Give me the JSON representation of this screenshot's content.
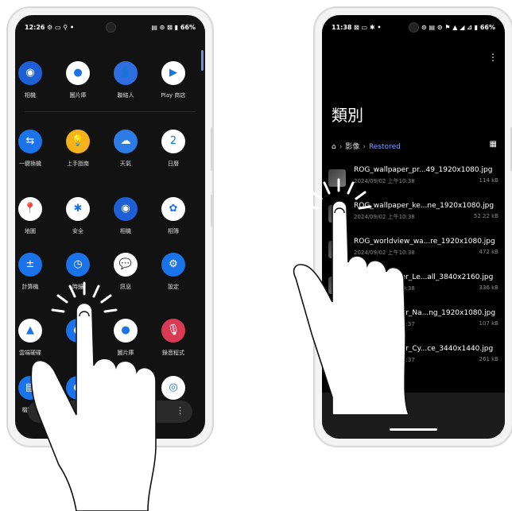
{
  "left_phone": {
    "status_bar": {
      "time": "12:26",
      "icons_left": "⚙ ▭ ⚲ •",
      "battery": "66%",
      "icons_right": "▤ ⊙ ⊠ ▮"
    },
    "apps": [
      {
        "label": "相機",
        "color": "#1f5fd6",
        "glyph": "◉"
      },
      {
        "label": "圖片庫",
        "color": "#ffffff",
        "glyph": "●"
      },
      {
        "label": "聯絡人",
        "color": "#2f6ee0",
        "glyph": "👤"
      },
      {
        "label": "Play 商店",
        "color": "#ffffff",
        "glyph": "▶"
      },
      {
        "label": "一鍵換機",
        "color": "#1a73e8",
        "glyph": "⇆"
      },
      {
        "label": "上手指南",
        "color": "#f6b21b",
        "glyph": "💡"
      },
      {
        "label": "天氣",
        "color": "#2d7be5",
        "glyph": "☁"
      },
      {
        "label": "日曆",
        "color": "#ffffff",
        "glyph": "2"
      },
      {
        "label": "地圖",
        "color": "#ffffff",
        "glyph": "📍"
      },
      {
        "label": "安全",
        "color": "#ffffff",
        "glyph": "✱"
      },
      {
        "label": "相機",
        "color": "#1f5fd6",
        "glyph": "◉"
      },
      {
        "label": "相簿",
        "color": "#ffffff",
        "glyph": "✿"
      },
      {
        "label": "計算機",
        "color": "#1a73e8",
        "glyph": "±"
      },
      {
        "label": "時鐘",
        "color": "#1a73e8",
        "glyph": "◷"
      },
      {
        "label": "訊息",
        "color": "#ffffff",
        "glyph": "💬"
      },
      {
        "label": "設定",
        "color": "#1a73e8",
        "glyph": "⚙"
      },
      {
        "label": "雲端硬碟",
        "color": "#ffffff",
        "glyph": "▲"
      },
      {
        "label": "",
        "color": "#1a73e8",
        "glyph": "●"
      },
      {
        "label": "圖片庫",
        "color": "#ffffff",
        "glyph": "●"
      },
      {
        "label": "錄音程式",
        "color": "#d93b55",
        "glyph": "🎙"
      },
      {
        "label": "檔案管",
        "color": "#1a73e8",
        "glyph": "▤"
      },
      {
        "label": "",
        "color": "#1a73e8",
        "glyph": "●"
      },
      {
        "label": "",
        "color": "#ffffff",
        "glyph": "✎"
      },
      {
        "label": "Chrome",
        "color": "#ffffff",
        "glyph": "◎"
      }
    ],
    "search_placeholder": "尋",
    "search_icon": "search-icon",
    "menu_icon": "more-vert-icon"
  },
  "right_phone": {
    "status_bar": {
      "time": "11:38",
      "icons_left": "⊠ ▭ ✱ •",
      "battery": "66%",
      "icons_right": "⊙ ▤ ⊙ ⚑ ▲ ◢ ⊿ ▮"
    },
    "title": "類別",
    "breadcrumb": {
      "home_icon": "home-icon",
      "items": [
        "影像",
        "Restored"
      ]
    },
    "files": [
      {
        "name": "ROG_wallpaper_pr...49_1920x1080.jpg",
        "date": "2024/09/02 上午10:38",
        "size": "114 kB"
      },
      {
        "name": "ROG_wallpaper_ke...ne_1920x1080.jpg",
        "date": "2024/09/02 上午10:38",
        "size": "52.22 kB"
      },
      {
        "name": "ROG_worldview_wa...re_1920x1080.jpg",
        "date": "2024/09/02 上午10:38",
        "size": "472 kB"
      },
      {
        "name": "ROG_wallpaper_Le...all_3840x2160.jpg",
        "date": "2024/09/02 上午10:38",
        "size": "336 kB"
      },
      {
        "name": "ROG_wallpaper_Na...ng_1920x1080.jpg",
        "date": "2024/09/02 上午10:37",
        "size": "107 kB"
      },
      {
        "name": "ROG_wallpaper_Cy...ce_3440x1440.jpg",
        "date": "2024/09/02 上午10:37",
        "size": "261 kB"
      }
    ]
  }
}
